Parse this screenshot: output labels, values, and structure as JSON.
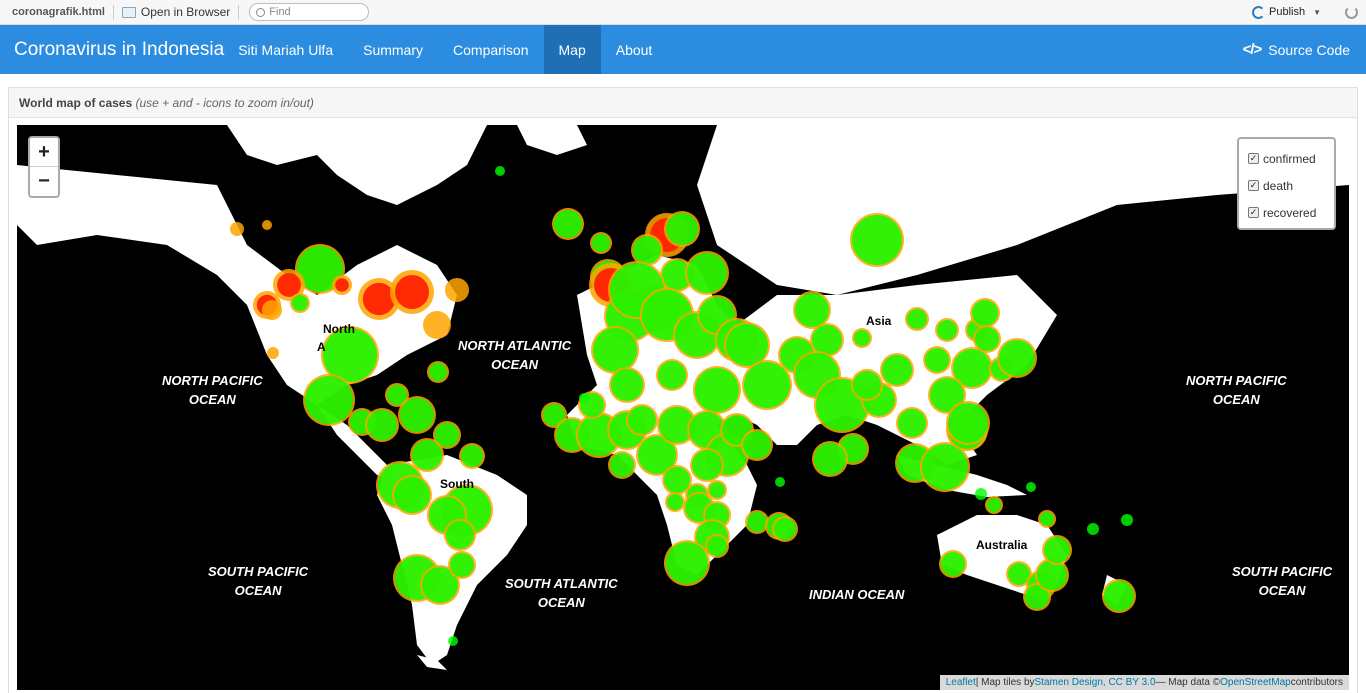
{
  "viewer": {
    "filename": "coronagrafik.html",
    "open_label": "Open in Browser",
    "find_placeholder": "Find",
    "publish_label": "Publish"
  },
  "navbar": {
    "brand": "Coronavirus in Indonesia",
    "author": "Siti Mariah Ulfa",
    "items": [
      "Summary",
      "Comparison",
      "Map",
      "About"
    ],
    "active": "Map",
    "source_code": "Source Code",
    "color": "#2b8ce0"
  },
  "panel": {
    "title": "World map of cases",
    "hint": "(use + and - icons to zoom in/out)"
  },
  "map": {
    "zoom_in": "+",
    "zoom_out": "−",
    "layers": [
      "confirmed",
      "death",
      "recovered"
    ],
    "layer_colors": {
      "confirmed": "#ffa500",
      "death": "#ff2200",
      "recovered": "#00ff00"
    },
    "ocean_labels": {
      "npac_left": "NORTH PACIFIC\nOCEAN",
      "natl": "NORTH ATLANTIC\nOCEAN",
      "npac_right": "NORTH PACIFIC\nOCEAN",
      "spac_left": "SOUTH PACIFIC\nOCEAN",
      "satl": "SOUTH ATLANTIC\nOCEAN",
      "indian": "INDIAN OCEAN",
      "spac_right": "SOUTH PACIFIC\nOCEAN"
    },
    "continent_labels": {
      "north": "North",
      "north_a": "A",
      "south": "South",
      "asia": "Asia",
      "australia": "Australia",
      "right_a": "A"
    },
    "attribution": {
      "leaflet": "Leaflet",
      "sep1": " | Map tiles by ",
      "stamen": "Stamen Design, CC BY 3.0",
      "sep2": " — Map data © ",
      "osm": "OpenStreetMap",
      "sep3": " contributors"
    }
  }
}
